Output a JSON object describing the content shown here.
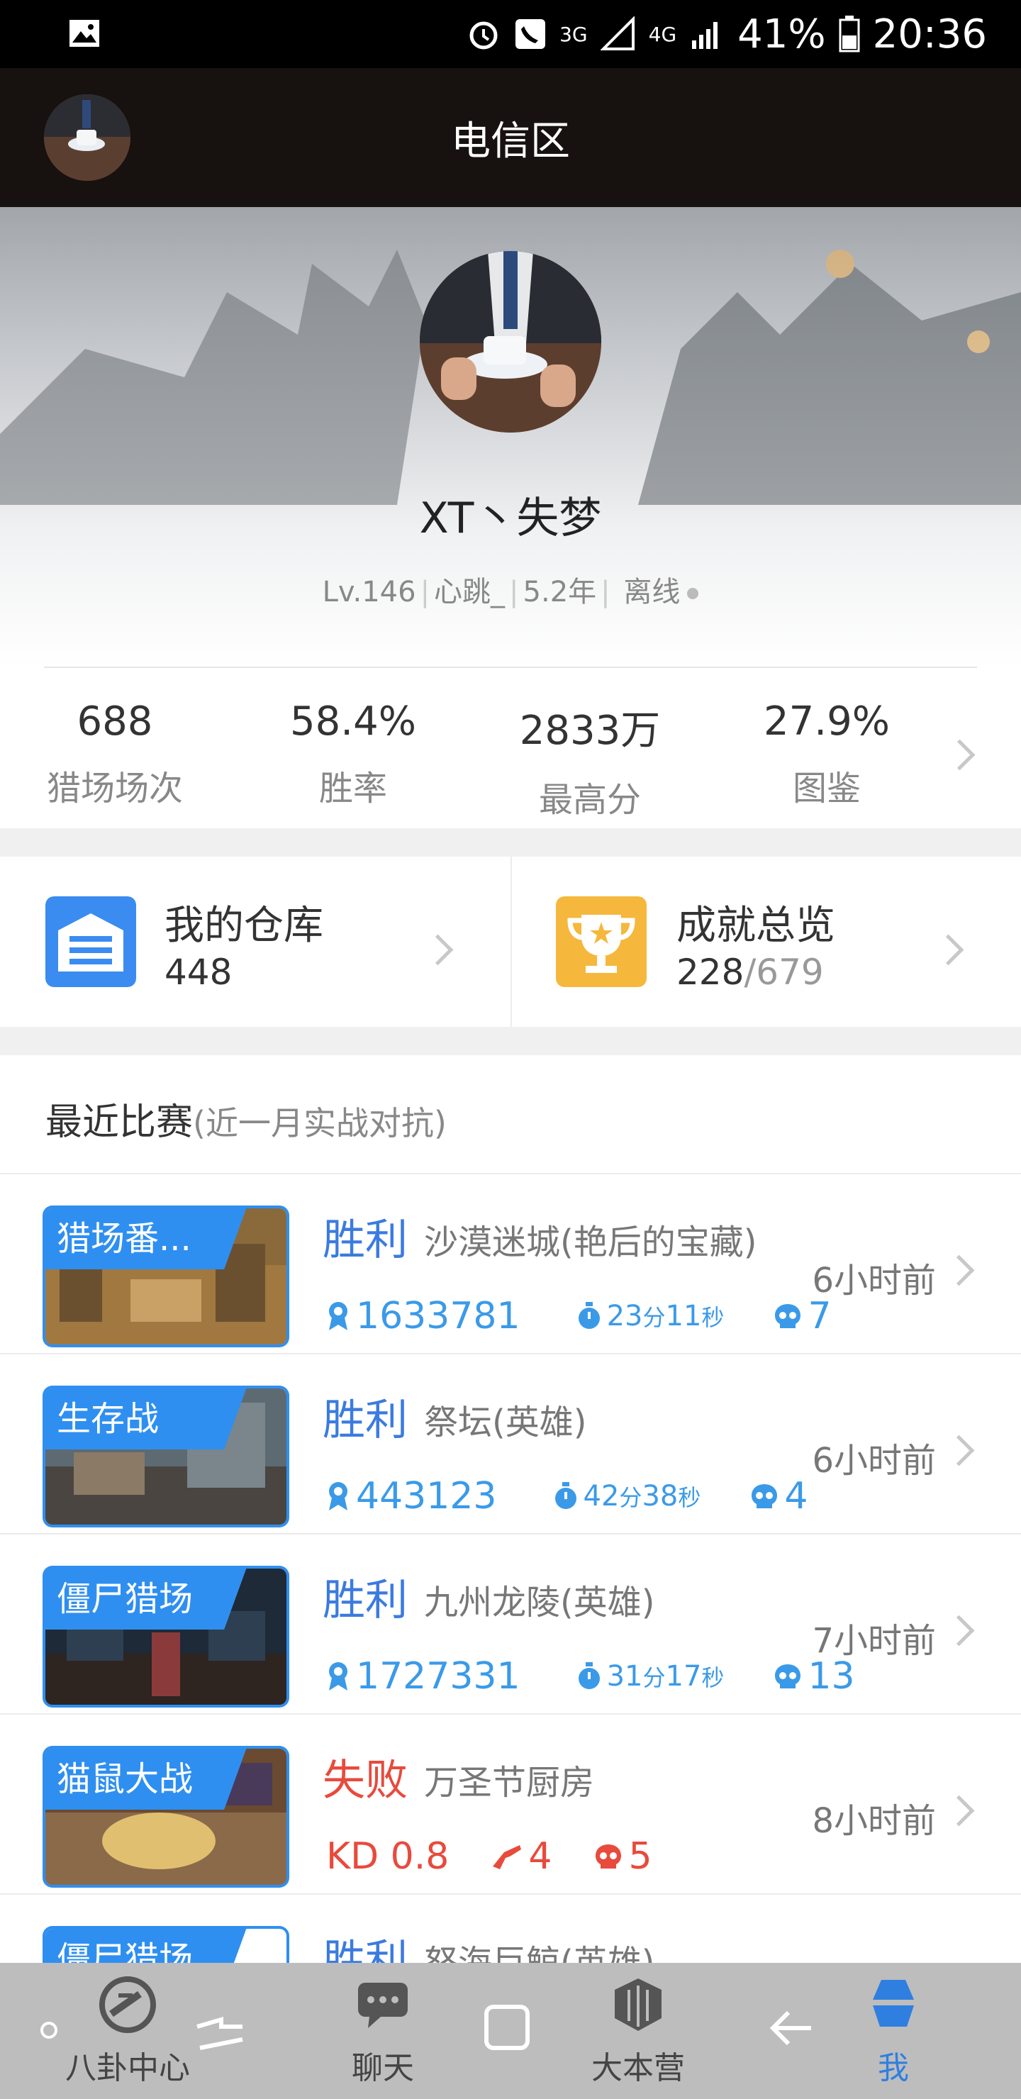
{
  "status_bar": {
    "network_3g": "3G",
    "network_4g": "4G",
    "battery": "41%",
    "time": "20:36"
  },
  "header": {
    "title": "电信区"
  },
  "profile": {
    "name": "XT丶失梦",
    "level": "Lv.146",
    "signature": "心跳_",
    "age": "5.2年",
    "status": "离线"
  },
  "stats": [
    {
      "value": "688",
      "label": "猎场场次"
    },
    {
      "value": "58.4%",
      "label": "胜率"
    },
    {
      "value": "2833万",
      "label": "最高分"
    },
    {
      "value": "27.9%",
      "label": "图鉴"
    }
  ],
  "cards": {
    "warehouse": {
      "title": "我的仓库",
      "count": "448"
    },
    "achievements": {
      "title": "成就总览",
      "done": "228",
      "total": "/679"
    }
  },
  "recent": {
    "title": "最近比赛",
    "note": "(近一月实战对抗)",
    "matches": [
      {
        "mode": "猎场番...",
        "result": "胜利",
        "map": "沙漠迷城(艳后的宝藏)",
        "time": "6小时前",
        "score": "1633781",
        "duration_min": "23",
        "duration_min_unit": "分",
        "duration_sec": "11",
        "duration_sec_unit": "秒",
        "kills": "7"
      },
      {
        "mode": "生存战",
        "result": "胜利",
        "map": "祭坛(英雄)",
        "time": "6小时前",
        "score": "443123",
        "duration_min": "42",
        "duration_min_unit": "分",
        "duration_sec": "38",
        "duration_sec_unit": "秒",
        "kills": "4"
      },
      {
        "mode": "僵尸猎场",
        "result": "胜利",
        "map": "九州龙陵(英雄)",
        "time": "7小时前",
        "score": "1727331",
        "duration_min": "31",
        "duration_min_unit": "分",
        "duration_sec": "17",
        "duration_sec_unit": "秒",
        "kills": "13"
      },
      {
        "mode": "猫鼠大战",
        "result": "失败",
        "map": "万圣节厨房",
        "time": "8小时前",
        "kd": "KD 0.8",
        "kills": "4",
        "deaths": "5"
      },
      {
        "mode": "僵尸猎场",
        "result": "胜利",
        "map": "怒海巨鲸(英雄)"
      }
    ]
  },
  "nav": {
    "items": [
      {
        "label": "八卦中心",
        "icon": "gossip-icon"
      },
      {
        "label": "聊天",
        "icon": "chat-icon"
      },
      {
        "label": "大本营",
        "icon": "base-icon"
      },
      {
        "label": "我",
        "icon": "me-icon"
      }
    ]
  },
  "colors": {
    "accent": "#2f8ff0",
    "win": "#3b7be0",
    "lose": "#e84a3c",
    "stat_blue": "#3b9ae8"
  }
}
